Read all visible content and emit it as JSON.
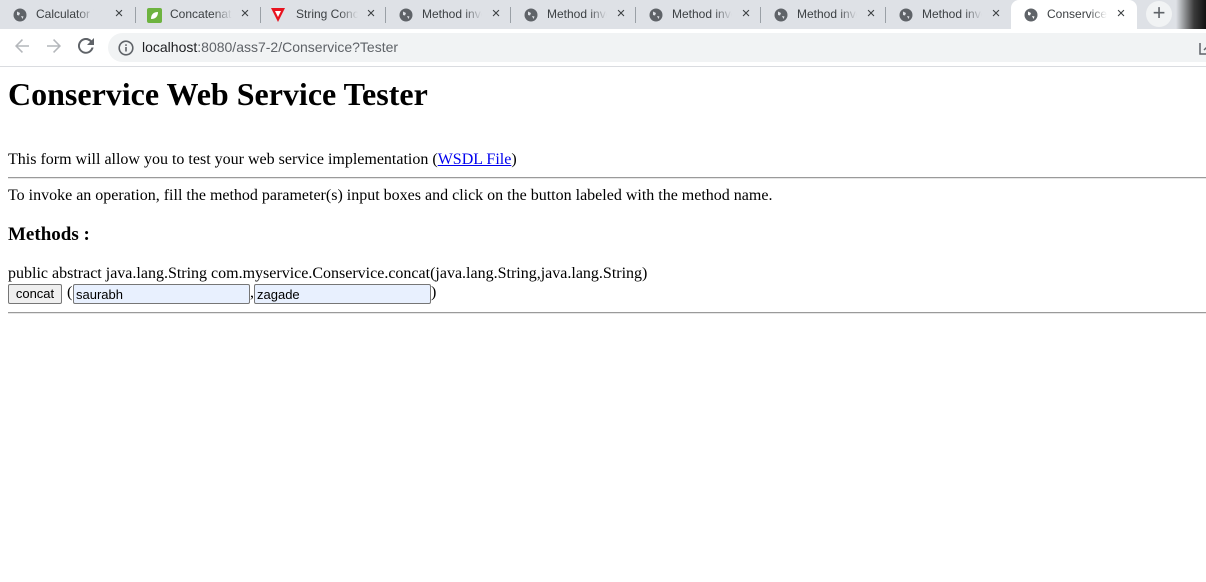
{
  "browser": {
    "tabs": [
      {
        "title": "Calculator Web Service",
        "icon": "globe-icon",
        "active": false
      },
      {
        "title": "Concatenation",
        "icon": "green-leaf-icon",
        "active": false
      },
      {
        "title": "String Concatenation",
        "icon": "red-triangle-icon",
        "active": false
      },
      {
        "title": "Method invocation",
        "icon": "globe-icon",
        "active": false
      },
      {
        "title": "Method invocation",
        "icon": "globe-icon",
        "active": false
      },
      {
        "title": "Method invocation",
        "icon": "globe-icon",
        "active": false
      },
      {
        "title": "Method invocation",
        "icon": "globe-icon",
        "active": false
      },
      {
        "title": "Method invocation",
        "icon": "globe-icon",
        "active": false
      },
      {
        "title": "Conservice Web Service Tester",
        "icon": "globe-icon",
        "active": true
      }
    ],
    "close_glyph": "×",
    "new_tab_glyph": "+",
    "url_host": "localhost",
    "url_path": ":8080/ass7-2/Conservice?Tester"
  },
  "page": {
    "title": "Conservice Web Service Tester",
    "intro_text": "This form will allow you to test your web service implementation (",
    "wsdl_link": "WSDL File",
    "intro_close": ")",
    "instructions": "To invoke an operation, fill the method parameter(s) input boxes and click on the button labeled with the method name.",
    "methods_heading": "Methods :",
    "method_signature": "public abstract java.lang.String com.myservice.Conservice.concat(java.lang.String,java.lang.String)",
    "method_button": "concat",
    "open_paren": "(",
    "comma": ",",
    "close_paren": ")",
    "param1_value": "saurabh",
    "param2_value": "zagade"
  },
  "colors": {
    "link": "#0000ee",
    "autofill_bg": "#e8f0fe",
    "chrome_bg": "#dee1e6"
  }
}
